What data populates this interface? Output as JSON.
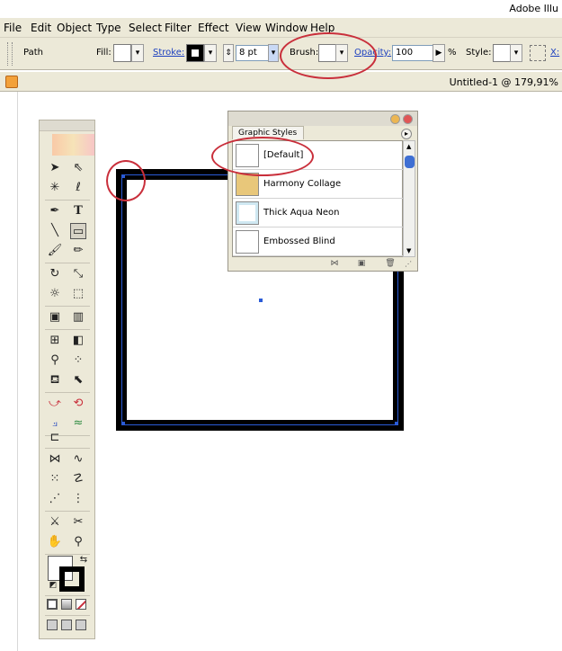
{
  "app_title": "Adobe Illu",
  "menu": [
    "File",
    "Edit",
    "Object",
    "Type",
    "Select",
    "Filter",
    "Effect",
    "View",
    "Window",
    "Help"
  ],
  "control_bar": {
    "object_type": "Path",
    "fill_label": "Fill:",
    "stroke_label": "Stroke:",
    "stroke_weight": "8 pt",
    "brush_label": "Brush:",
    "opacity_label": "Opacity:",
    "opacity_value": "100",
    "percent": "%",
    "style_label": "Style:",
    "cut_text": "X:"
  },
  "document": {
    "title": "Untitled-1 @ 179,91%"
  },
  "graphic_styles_panel": {
    "tab_label": "Graphic Styles",
    "menu_icon": "panel-menu-icon",
    "styles": [
      {
        "name": "[Default]",
        "thumb": "#ffffff"
      },
      {
        "name": "Harmony Collage",
        "thumb": "#e8c77a"
      },
      {
        "name": "Thick Aqua Neon",
        "thumb": "#cfe8f2"
      },
      {
        "name": "Embossed Blind",
        "thumb": "#ffffff"
      }
    ]
  },
  "colors": {
    "ui_bg": "#ece9d8",
    "link": "#1b3fbf",
    "selection": "#2a5bd7",
    "annotation": "#c92f3b",
    "stroke": "#000000"
  }
}
